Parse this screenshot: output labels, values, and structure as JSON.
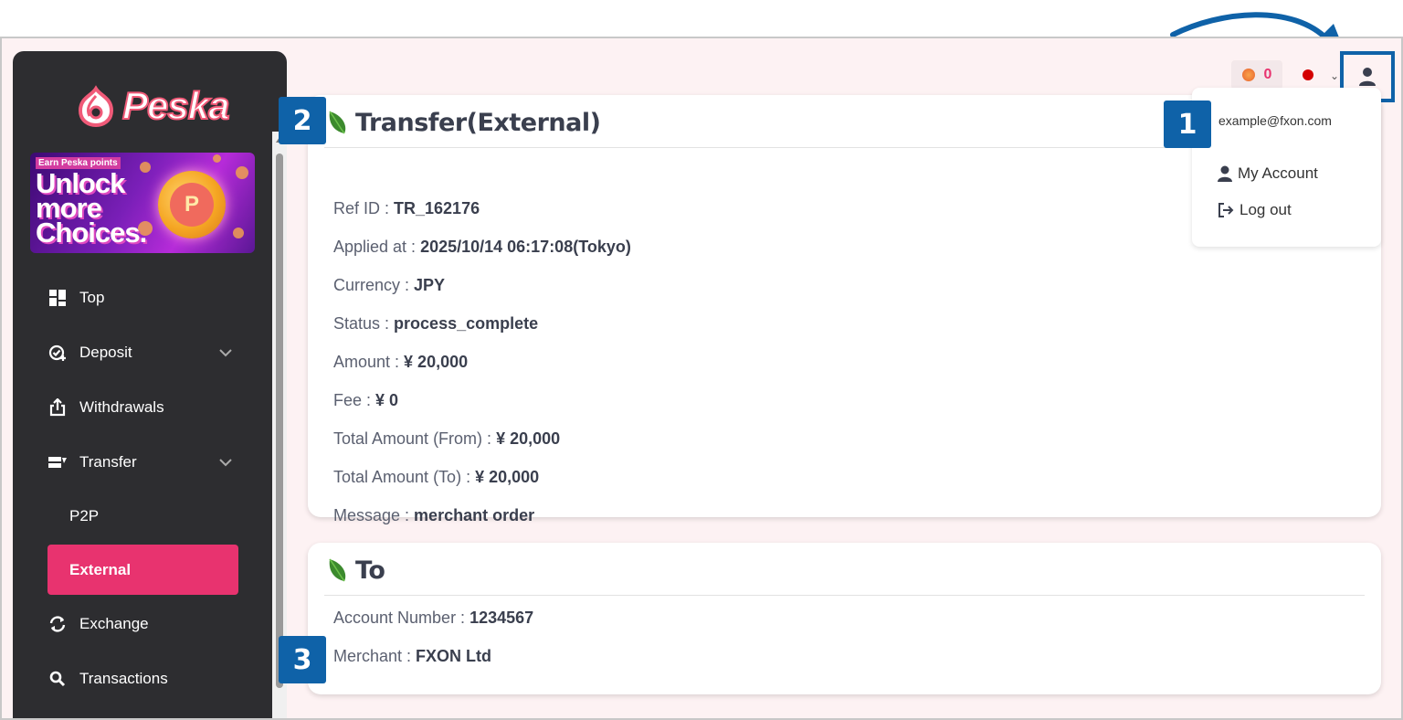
{
  "brand": {
    "name": "Peska",
    "accent": "#e8336f",
    "callout": "#0f62a8"
  },
  "banner": {
    "small": "Earn Peska points",
    "headline_1": "Unlock",
    "headline_2": "more",
    "headline_3": "Choices.",
    "coin_letter": "P"
  },
  "sidebar": {
    "items": [
      {
        "label": "Top",
        "icon": "dashboard-icon"
      },
      {
        "label": "Deposit",
        "icon": "deposit-icon",
        "expandable": true
      },
      {
        "label": "Withdrawals",
        "icon": "withdrawals-icon"
      },
      {
        "label": "Transfer",
        "icon": "transfer-icon",
        "expandable": true,
        "expanded": true
      },
      {
        "label": "P2P",
        "sub": true
      },
      {
        "label": "External",
        "sub": true,
        "active": true
      },
      {
        "label": "Exchange",
        "icon": "exchange-icon"
      },
      {
        "label": "Transactions",
        "icon": "search-icon"
      }
    ]
  },
  "topbar": {
    "points": "0",
    "flag": "japan-flag",
    "user_icon": "user-icon"
  },
  "dropdown": {
    "email": "example@fxon.com",
    "my_account": "My Account",
    "logout": "Log out"
  },
  "transfer": {
    "title": "Transfer(External)",
    "fields": [
      {
        "label": "Ref ID : ",
        "value": "TR_162176"
      },
      {
        "label": "Applied at : ",
        "value": "2025/10/14 06:17:08(Tokyo)"
      },
      {
        "label": "Currency : ",
        "value": "JPY"
      },
      {
        "label": "Status : ",
        "value": "process_complete"
      },
      {
        "label": "Amount : ",
        "value": "¥ 20,000"
      },
      {
        "label": "Fee : ",
        "value": "¥ 0"
      },
      {
        "label": "Total Amount (From) : ",
        "value": "¥ 20,000"
      },
      {
        "label": "Total Amount (To) : ",
        "value": "¥ 20,000"
      },
      {
        "label": "Message : ",
        "value": "merchant order"
      }
    ]
  },
  "to": {
    "title": "To",
    "fields": [
      {
        "label": "Account Number : ",
        "value": "1234567"
      },
      {
        "label": "Merchant : ",
        "value": "FXON Ltd"
      }
    ]
  },
  "callouts": [
    "1",
    "2",
    "3"
  ]
}
